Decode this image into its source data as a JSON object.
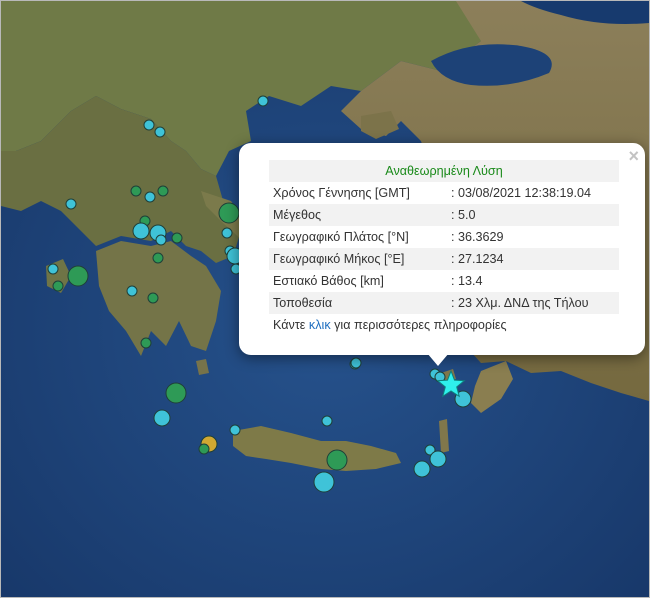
{
  "map": {
    "colors": {
      "sea_deep": "#1a3d73",
      "sea": "#24508a",
      "land": "#8a7d56",
      "land_green": "#5f6c3c",
      "quake_cyan": "#3fc3d8",
      "quake_green": "#2e9a56",
      "quake_gold": "#d1a832",
      "mainshock": "#2ff0ec"
    },
    "earthquakes": [
      {
        "color": "cyan",
        "size": "small"
      },
      {
        "color": "cyan",
        "size": "small"
      },
      {
        "color": "cyan",
        "size": "small"
      },
      {
        "color": "green",
        "size": "small"
      },
      {
        "color": "green",
        "size": "small"
      },
      {
        "color": "cyan",
        "size": "small"
      },
      {
        "color": "cyan",
        "size": "small"
      },
      {
        "color": "green",
        "size": "small"
      },
      {
        "color": "cyan",
        "size": "medium"
      },
      {
        "color": "cyan",
        "size": "medium"
      },
      {
        "color": "cyan",
        "size": "small"
      },
      {
        "color": "green",
        "size": "small"
      },
      {
        "color": "cyan",
        "size": "small"
      },
      {
        "color": "cyan",
        "size": "small"
      },
      {
        "color": "green",
        "size": "small"
      },
      {
        "color": "cyan",
        "size": "small"
      },
      {
        "color": "cyan",
        "size": "small"
      },
      {
        "color": "green",
        "size": "large"
      },
      {
        "color": "green",
        "size": "small"
      },
      {
        "color": "cyan",
        "size": "small"
      },
      {
        "color": "green",
        "size": "small"
      },
      {
        "color": "green",
        "size": "small"
      },
      {
        "color": "green",
        "size": "large"
      },
      {
        "color": "cyan",
        "size": "medium"
      },
      {
        "color": "gold",
        "size": "medium"
      },
      {
        "color": "cyan",
        "size": "small"
      },
      {
        "color": "green",
        "size": "small"
      },
      {
        "color": "cyan",
        "size": "small"
      },
      {
        "color": "cyan",
        "size": "small"
      },
      {
        "color": "green",
        "size": "large"
      },
      {
        "color": "cyan",
        "size": "large"
      },
      {
        "color": "cyan",
        "size": "small"
      },
      {
        "color": "cyan",
        "size": "medium"
      },
      {
        "color": "cyan",
        "size": "medium"
      },
      {
        "color": "cyan",
        "size": "medium"
      },
      {
        "color": "cyan",
        "size": "small"
      },
      {
        "color": "cyan",
        "size": "small"
      },
      {
        "color": "green",
        "size": "large"
      },
      {
        "color": "cyan",
        "size": "medium"
      },
      {
        "color": "cyan",
        "size": "small"
      }
    ],
    "mainshock_marker": "star-icon"
  },
  "popup": {
    "title": "Αναθεωρημένη Λύση",
    "rows": [
      {
        "label": "Χρόνος Γέννησης [GMT]",
        "value": ": 03/08/2021 12:38:19.04"
      },
      {
        "label": "Μέγεθος",
        "value": ": 5.0"
      },
      {
        "label": "Γεωγραφικό Πλάτος [°N]",
        "value": ": 36.3629"
      },
      {
        "label": "Γεωγραφικό Μήκος [°E]",
        "value": ": 27.1234"
      },
      {
        "label": "Εστιακό Βάθος [km]",
        "value": ": 13.4"
      },
      {
        "label": "Τοποθεσία",
        "value": ": 23 Χλμ. ΔΝΔ της Τήλου"
      }
    ],
    "more_prefix": "Κάντε",
    "more_link": "κλικ",
    "more_suffix": "για περισσότερες πληροφορίες",
    "close_symbol": "×",
    "close_icon": "close-icon"
  }
}
